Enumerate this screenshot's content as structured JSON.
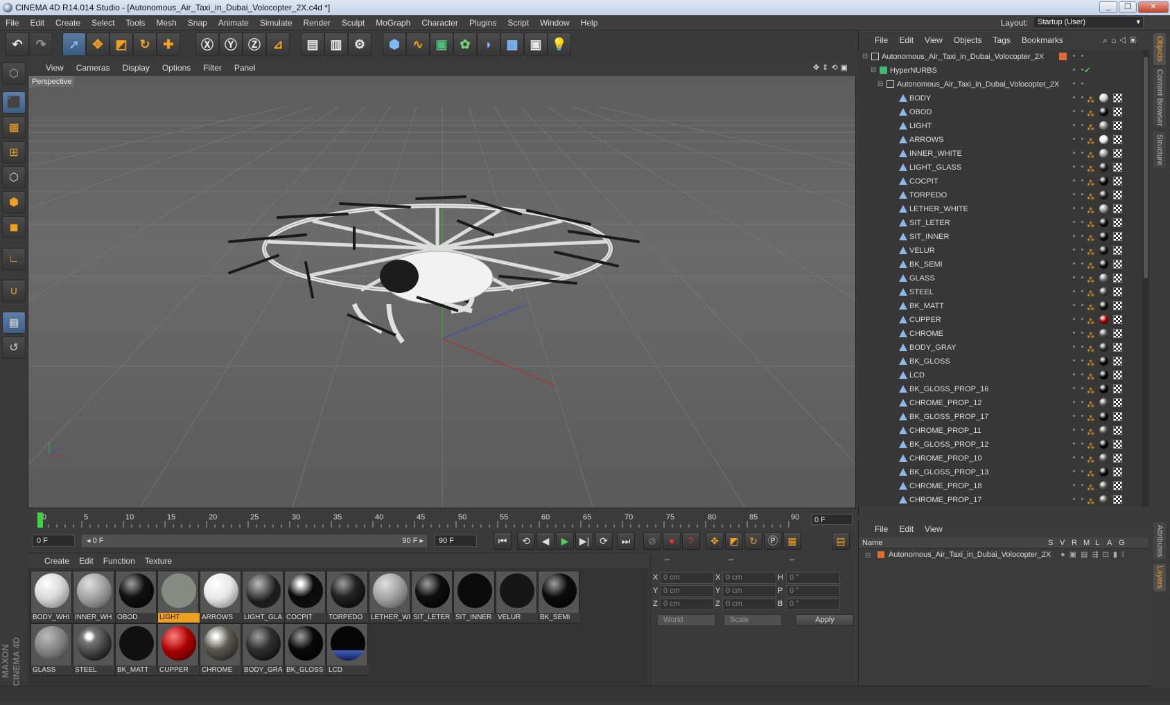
{
  "window": {
    "title": "CINEMA 4D R14.014 Studio - [Autonomous_Air_Taxi_in_Dubai_Volocopter_2X.c4d *]",
    "minimize": "_",
    "restore": "❐",
    "close": "✕"
  },
  "menubar": [
    "File",
    "Edit",
    "Create",
    "Select",
    "Tools",
    "Mesh",
    "Snap",
    "Animate",
    "Simulate",
    "Render",
    "Sculpt",
    "MoGraph",
    "Character",
    "Plugins",
    "Script",
    "Window",
    "Help"
  ],
  "layout": {
    "label": "Layout:",
    "value": "Startup (User)"
  },
  "viewport": {
    "menu": [
      "View",
      "Cameras",
      "Display",
      "Options",
      "Filter",
      "Panel"
    ],
    "label": "Perspective"
  },
  "timeline": {
    "ticks": [
      "0",
      "5",
      "10",
      "15",
      "20",
      "25",
      "30",
      "35",
      "40",
      "45",
      "50",
      "55",
      "60",
      "65",
      "70",
      "75",
      "80",
      "85",
      "90"
    ],
    "frame_display": "0 F"
  },
  "transport": {
    "start_field": "0 F",
    "range_start": "◂ 0 F",
    "range_end": "90 F ▸",
    "end_field": "90 F"
  },
  "materials_menu": [
    "Create",
    "Edit",
    "Function",
    "Texture"
  ],
  "materials": [
    {
      "name": "BODY_WHI",
      "color": "#d8d8d8",
      "type": "light"
    },
    {
      "name": "INNER_WH",
      "color": "#9a9a9a",
      "type": "mid"
    },
    {
      "name": "OBOD",
      "color": "#111111",
      "type": "dark"
    },
    {
      "name": "LIGHT",
      "color": "#878a80",
      "type": "flat",
      "selected": true
    },
    {
      "name": "ARROWS",
      "color": "#e8e8e8",
      "type": "light"
    },
    {
      "name": "LIGHT_GLA",
      "color": "#1a1a1a",
      "type": "glass"
    },
    {
      "name": "COCPIT",
      "color": "#0a0a0a",
      "type": "env"
    },
    {
      "name": "TORPEDO",
      "color": "#222222",
      "type": "dark"
    },
    {
      "name": "LETHER_WI",
      "color": "#9b9b9b",
      "type": "mid"
    },
    {
      "name": "SIT_LETER",
      "color": "#0e0e0e",
      "type": "dark"
    },
    {
      "name": "SIT_INNER",
      "color": "#0b0b0b",
      "type": "flat"
    },
    {
      "name": "VELUR",
      "color": "#151515",
      "type": "flat"
    },
    {
      "name": "BK_SEMI",
      "color": "#0c0c0c",
      "type": "dark"
    },
    {
      "name": "GLASS",
      "color": "#777777",
      "type": "glass"
    },
    {
      "name": "STEEL",
      "color": "#333333",
      "type": "steel"
    },
    {
      "name": "BK_MATT",
      "color": "#101010",
      "type": "flat"
    },
    {
      "name": "CUPPER",
      "color": "#aa0000",
      "type": "red"
    },
    {
      "name": "CHROME",
      "color": "#5a5a50",
      "type": "env"
    },
    {
      "name": "BODY_GRA",
      "color": "#303030",
      "type": "dark"
    },
    {
      "name": "BK_GLOSS",
      "color": "#080808",
      "type": "dark"
    },
    {
      "name": "LCD",
      "color": "#050505",
      "type": "lcd"
    }
  ],
  "coords": {
    "headers": [
      "--",
      "--",
      "--"
    ],
    "rows": [
      {
        "a": "X",
        "av": "0 cm",
        "b": "X",
        "bv": "0 cm",
        "c": "H",
        "cv": "0 °"
      },
      {
        "a": "Y",
        "av": "0 cm",
        "b": "Y",
        "bv": "0 cm",
        "c": "P",
        "cv": "0 °"
      },
      {
        "a": "Z",
        "av": "0 cm",
        "b": "Z",
        "bv": "0 cm",
        "c": "B",
        "cv": "0 °"
      }
    ],
    "space": "World",
    "mode": "Scale",
    "apply": "Apply"
  },
  "objects_menu": [
    "File",
    "Edit",
    "View",
    "Objects",
    "Tags",
    "Bookmarks"
  ],
  "objects": [
    {
      "name": "Autonomous_Air_Taxi_in_Dubai_Volocopter_2X",
      "level": 0,
      "kind": "null"
    },
    {
      "name": "HyperNURBS",
      "level": 1,
      "kind": "nurbs"
    },
    {
      "name": "Autonomous_Air_Taxi_in_Dubai_Volocopter_2X",
      "level": 2,
      "kind": "null"
    },
    {
      "name": "BODY",
      "level": 3,
      "kind": "poly",
      "tag": "#cfcfcf"
    },
    {
      "name": "OBOD",
      "level": 3,
      "kind": "poly",
      "tag": "#111111"
    },
    {
      "name": "LIGHT",
      "level": 3,
      "kind": "poly",
      "tag": "#8a8a80"
    },
    {
      "name": "ARROWS",
      "level": 3,
      "kind": "poly",
      "tag": "#eeeeee"
    },
    {
      "name": "INNER_WHITE",
      "level": 3,
      "kind": "poly",
      "tag": "#9a9a9a"
    },
    {
      "name": "LIGHT_GLASS",
      "level": 3,
      "kind": "poly",
      "tag": "#222222"
    },
    {
      "name": "COCPIT",
      "level": 3,
      "kind": "poly",
      "tag": "#0a0a0a"
    },
    {
      "name": "TORPEDO",
      "level": 3,
      "kind": "poly",
      "tag": "#222222"
    },
    {
      "name": "LETHER_WHITE",
      "level": 3,
      "kind": "poly",
      "tag": "#a0a0a0"
    },
    {
      "name": "SIT_LETER",
      "level": 3,
      "kind": "poly",
      "tag": "#0e0e0e"
    },
    {
      "name": "SIT_INNER",
      "level": 3,
      "kind": "poly",
      "tag": "#0b0b0b"
    },
    {
      "name": "VELUR",
      "level": 3,
      "kind": "poly",
      "tag": "#151515"
    },
    {
      "name": "BK_SEMI",
      "level": 3,
      "kind": "poly",
      "tag": "#0c0c0c"
    },
    {
      "name": "GLASS",
      "level": 3,
      "kind": "poly",
      "tag": "#777777"
    },
    {
      "name": "STEEL",
      "level": 3,
      "kind": "poly",
      "tag": "#444444"
    },
    {
      "name": "BK_MATT",
      "level": 3,
      "kind": "poly",
      "tag": "#101010"
    },
    {
      "name": "CUPPER",
      "level": 3,
      "kind": "poly",
      "tag": "#aa0000"
    },
    {
      "name": "CHROME",
      "level": 3,
      "kind": "poly",
      "tag": "#5a5a50"
    },
    {
      "name": "BODY_GRAY",
      "level": 3,
      "kind": "poly",
      "tag": "#303030"
    },
    {
      "name": "BK_GLOSS",
      "level": 3,
      "kind": "poly",
      "tag": "#080808"
    },
    {
      "name": "LCD",
      "level": 3,
      "kind": "poly",
      "tag": "#050505"
    },
    {
      "name": "BK_GLOSS_PROP_16",
      "level": 3,
      "kind": "poly",
      "tag": "#080808"
    },
    {
      "name": "CHROME_PROP_12",
      "level": 3,
      "kind": "poly",
      "tag": "#5a5a50"
    },
    {
      "name": "BK_GLOSS_PROP_17",
      "level": 3,
      "kind": "poly",
      "tag": "#080808"
    },
    {
      "name": "CHROME_PROP_11",
      "level": 3,
      "kind": "poly",
      "tag": "#5a5a50"
    },
    {
      "name": "BK_GLOSS_PROP_12",
      "level": 3,
      "kind": "poly",
      "tag": "#080808"
    },
    {
      "name": "CHROME_PROP_10",
      "level": 3,
      "kind": "poly",
      "tag": "#5a5a50"
    },
    {
      "name": "BK_GLOSS_PROP_13",
      "level": 3,
      "kind": "poly",
      "tag": "#080808"
    },
    {
      "name": "CHROME_PROP_18",
      "level": 3,
      "kind": "poly",
      "tag": "#5a5a50"
    },
    {
      "name": "CHROME_PROP_17",
      "level": 3,
      "kind": "poly",
      "tag": "#5a5a50"
    }
  ],
  "side_tabs": [
    "Objects",
    "Content Browser",
    "Structure",
    "Attributes",
    "Layers"
  ],
  "layers_menu": [
    "File",
    "Edit",
    "View"
  ],
  "layers_head": {
    "name": "Name",
    "cols": [
      "S",
      "V",
      "R",
      "M",
      "L",
      "A",
      "G"
    ]
  },
  "layers_row": "Autonomous_Air_Taxi_in_Dubai_Volocopter_2X",
  "maxon": "MAXON CINEMA 4D",
  "colors": {
    "accent": "#f0a020",
    "bg": "#3a3a3a",
    "viewport": "#646464"
  }
}
